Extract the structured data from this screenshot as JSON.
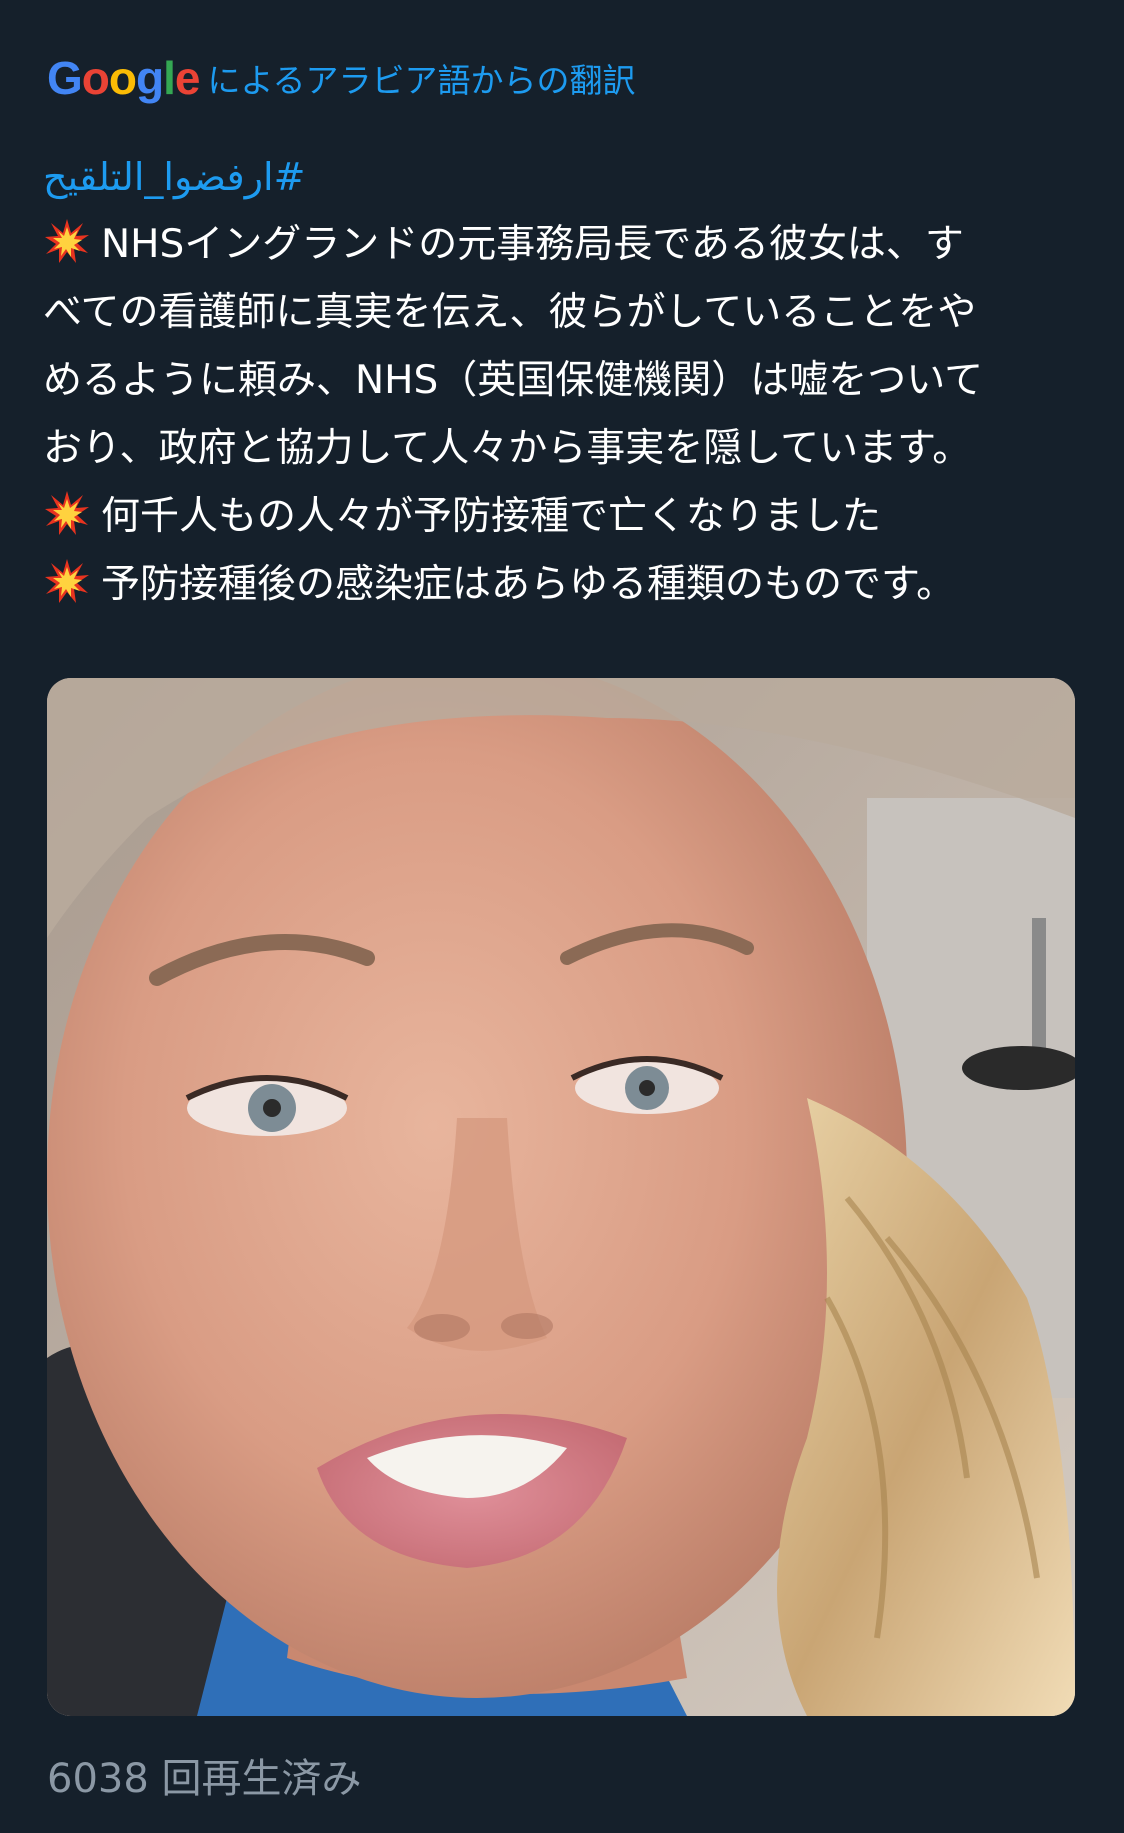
{
  "translation": {
    "google_letters": [
      {
        "char": "G",
        "color": "#4285f4"
      },
      {
        "char": "o",
        "color": "#ea4335"
      },
      {
        "char": "o",
        "color": "#fbbc05"
      },
      {
        "char": "g",
        "color": "#4285f4"
      },
      {
        "char": "l",
        "color": "#34a853"
      },
      {
        "char": "e",
        "color": "#ea4335"
      }
    ],
    "label": "によるアラビア語からの翻訳"
  },
  "tweet": {
    "hashtag": "#ارفضوا_التلقيح",
    "paragraph1_lines": [
      "NHSイングランドの元事務局長である彼女は、す",
      "べての看護師に真実を伝え、彼らがしていることをや",
      "めるように頼み、NHS（英国保健機関）は嘘をついて",
      "おり、政府と協力して人々から事実を隠しています。"
    ],
    "line2": "何千人もの人々が予防接種で亡くなりました",
    "line3": "予防接種後の感染症はあらゆる種類のものです。",
    "burst_icon": "collision-icon"
  },
  "media": {
    "type": "video",
    "description_icon": "video-thumbnail"
  },
  "view_count": "6038 回再生済み",
  "colors": {
    "background": "#15202b",
    "link_blue": "#1d9bf0",
    "secondary_text": "#8b98a5"
  }
}
